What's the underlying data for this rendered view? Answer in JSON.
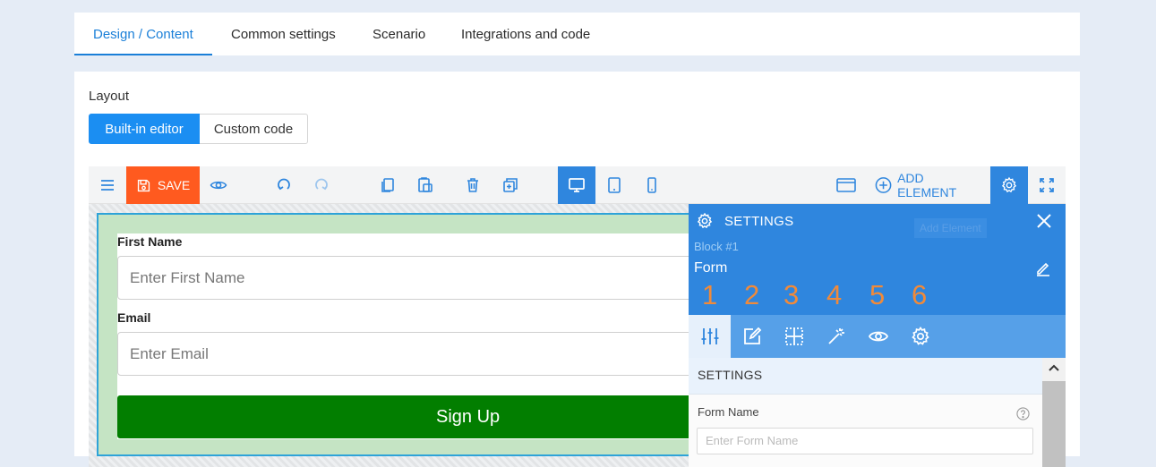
{
  "tabs": [
    {
      "label": "Design / Content"
    },
    {
      "label": "Common settings"
    },
    {
      "label": "Scenario"
    },
    {
      "label": "Integrations and code"
    }
  ],
  "layout": {
    "label": "Layout",
    "builtin_label": "Built-in editor",
    "custom_label": "Custom code"
  },
  "toolbar": {
    "save_label": "SAVE",
    "add_element_label": "ADD ELEMENT"
  },
  "form": {
    "first_name_label": "First Name",
    "first_name_placeholder": "Enter First Name",
    "email_label": "Email",
    "email_placeholder": "Enter Email",
    "submit_label": "Sign Up"
  },
  "panel": {
    "title": "SETTINGS",
    "ghost_label": "Add Element",
    "block_label": "Block #1",
    "element_name": "Form",
    "step_numbers": [
      "1",
      "2",
      "3",
      "4",
      "5",
      "6"
    ],
    "section_title": "SETTINGS",
    "form_name_label": "Form Name",
    "form_name_placeholder": "Enter Form Name"
  },
  "colors": {
    "accent": "#2f86de",
    "save": "#ff5a1f",
    "submit": "#027e00",
    "form_bg": "#c5e4c4",
    "step_numbers": "#f08a3a"
  }
}
